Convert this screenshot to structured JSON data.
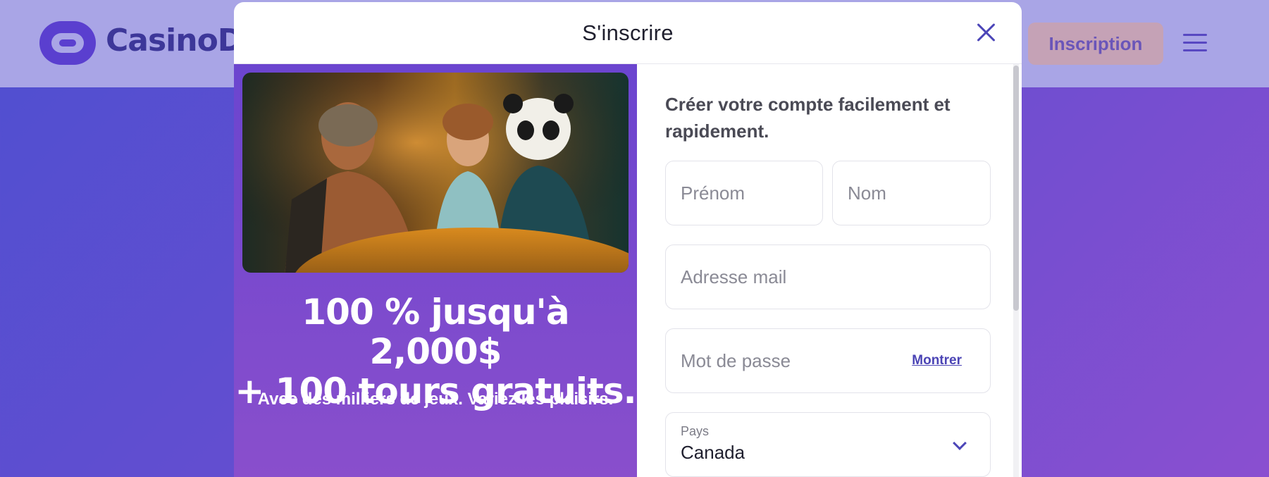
{
  "background": {
    "logo_text": "CasinoDa",
    "signup_button": "Inscription"
  },
  "modal": {
    "title": "S'inscrire",
    "close_icon": "close-icon"
  },
  "promo": {
    "headline_line1": "100 % jusqu'à 2,000$",
    "headline_line2": "+ 100 tours gratuits.",
    "subtext": "Avec des milliers de jeux. Variez les plaisirs."
  },
  "form": {
    "intro": "Créer votre compte facilement et rapidement.",
    "first_name_placeholder": "Prénom",
    "last_name_placeholder": "Nom",
    "email_placeholder": "Adresse mail",
    "password_placeholder": "Mot de passe",
    "show_password_label": "Montrer",
    "country_label": "Pays",
    "country_value": "Canada"
  },
  "colors": {
    "accent": "#4c46b8",
    "promo_bg": "#7a4acf",
    "page_bg": "#5a4fd0"
  }
}
